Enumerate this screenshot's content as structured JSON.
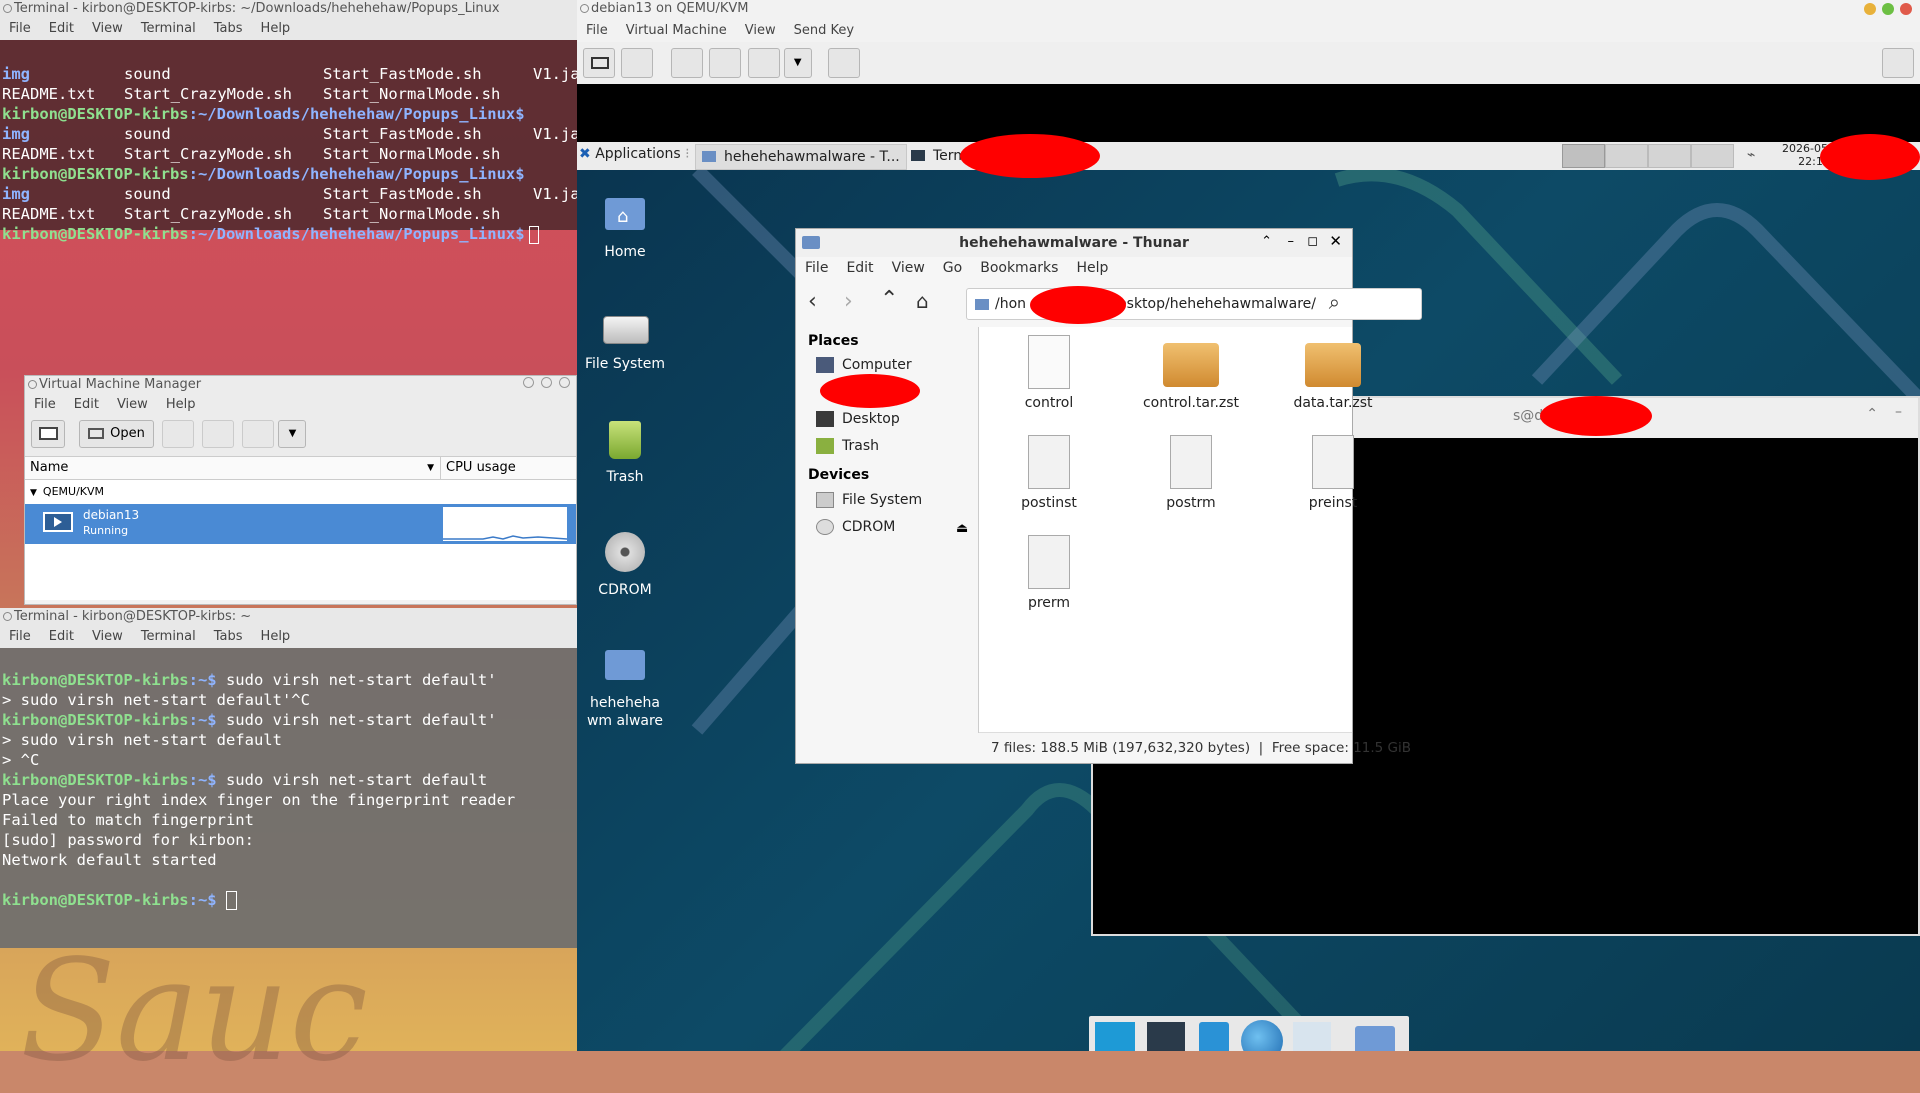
{
  "host": {
    "wallpaper_text": "Sauc",
    "terminal_top": {
      "title": "Terminal - kirbon@DESKTOP-kirbs: ~/Downloads/hehehehaw/Popups_Linux",
      "menu": [
        "File",
        "Edit",
        "View",
        "Terminal",
        "Tabs",
        "Help"
      ],
      "prompt": "kirbon@DESKTOP-kirbs",
      "path": ":~/Downloads/hehehehaw/Popups_Linux$",
      "ls_row1": {
        "c1": "img",
        "c2": "sound",
        "c3": "Start_FastMode.sh",
        "c4": "V1.ja"
      },
      "ls_row2": {
        "c1": "README.txt",
        "c2": "Start_CrazyMode.sh",
        "c3": "Start_NormalMode.sh"
      }
    },
    "vmm": {
      "title": "Virtual Machine Manager",
      "menu": [
        "File",
        "Edit",
        "View",
        "Help"
      ],
      "open_label": "Open",
      "col_name": "Name",
      "col_cpu": "CPU usage",
      "group": "QEMU/KVM",
      "vm_name": "debian13",
      "vm_status": "Running"
    },
    "terminal_bottom": {
      "title": "Terminal - kirbon@DESKTOP-kirbs: ~",
      "menu": [
        "File",
        "Edit",
        "View",
        "Terminal",
        "Tabs",
        "Help"
      ],
      "prompt": "kirbon@DESKTOP-kirbs",
      "prompt_suffix": ":~$",
      "cmd1": " sudo virsh net-start default'",
      "line2": "> sudo virsh net-start default'^C",
      "cmd3": " sudo virsh net-start default'",
      "line4": "> sudo virsh net-start default",
      "line5": "> ^C",
      "cmd6": " sudo virsh net-start default",
      "out1": "Place your right index finger on the fingerprint reader",
      "out2": "Failed to match fingerprint",
      "out3": "[sudo] password for kirbon:",
      "out4": "Network default started"
    }
  },
  "vm_window": {
    "title": "debian13 on QEMU/KVM",
    "menu": [
      "File",
      "Virtual Machine",
      "View",
      "Send Key"
    ]
  },
  "guest": {
    "panel": {
      "applications": "Applications",
      "task1": "hehehehawmalware - T...",
      "task2": "Term",
      "clock": "2026-05-2",
      "clock2": "22:1"
    },
    "desktop_icons": [
      "Home",
      "File System",
      "Trash",
      "CDROM",
      "hehehehawm alware"
    ],
    "bg_window_title": "s@debian",
    "thunar": {
      "title": "hehehehawmalware - Thunar",
      "menu": [
        "File",
        "Edit",
        "View",
        "Go",
        "Bookmarks",
        "Help"
      ],
      "path_left": "/hon",
      "path_right": "esktop/hehehehawmalware/",
      "places_header": "Places",
      "places": [
        "Computer",
        "Desktop",
        "Trash"
      ],
      "devices_header": "Devices",
      "devices": [
        "File System",
        "CDROM"
      ],
      "files": [
        "control",
        "control.tar.zst",
        "data.tar.zst",
        "postinst",
        "postrm",
        "preinst",
        "prerm"
      ],
      "status": "7 files: 188.5 MiB (197,632,320 bytes)  |  Free space: 11.5 GiB"
    }
  }
}
